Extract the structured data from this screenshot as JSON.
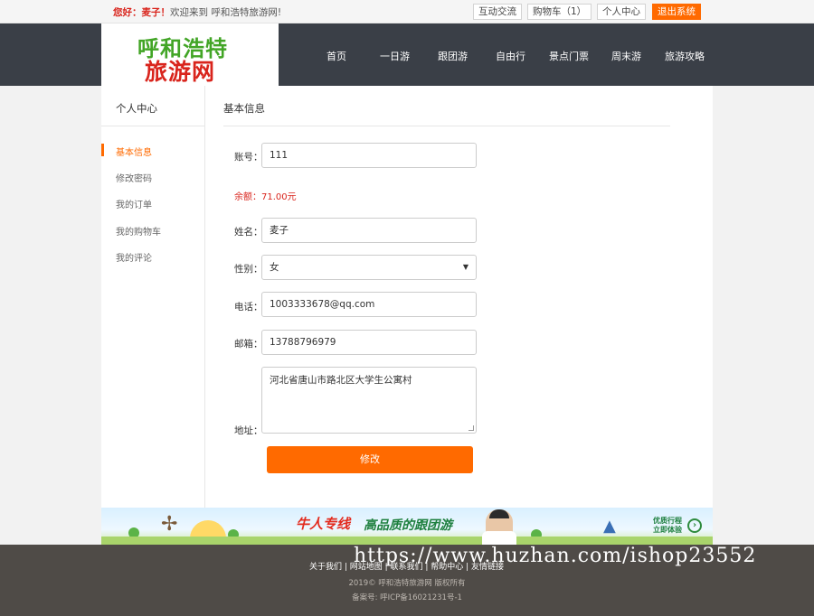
{
  "topbar": {
    "greeting": "您好：麦子！",
    "welcome": "欢迎来到 呼和浩特旅游网!",
    "buttons": [
      "互动交流",
      "购物车（1）",
      "个人中心",
      "退出系统"
    ]
  },
  "logo": {
    "line1": "呼和浩特",
    "line2": "旅游网"
  },
  "nav": [
    "首页",
    "一日游",
    "跟团游",
    "自由行",
    "景点门票",
    "周末游",
    "旅游攻略"
  ],
  "sidebar": {
    "title": "个人中心",
    "items": [
      "基本信息",
      "修改密码",
      "我的订单",
      "我的购物车",
      "我的评论"
    ],
    "active_index": 0
  },
  "form": {
    "title": "基本信息",
    "account_label": "账号：",
    "account_value": "111",
    "balance_text": "余额：71.00元",
    "name_label": "姓名：",
    "name_value": "麦子",
    "gender_label": "性别：",
    "gender_value": "女",
    "phone_label": "电话：",
    "phone_value": "1003333678@qq.com",
    "email_label": "邮箱：",
    "email_value": "13788796979",
    "address_label": "地址：",
    "address_value": "河北省唐山市路北区大学生公寓村",
    "submit_label": "修改"
  },
  "banner": {
    "slogan_red": "牛人专线",
    "slogan_green": "高品质的跟团游",
    "side_line1": "优质行程",
    "side_line2": "立即体验"
  },
  "footer": {
    "links": "关于我们 | 网站地图 | 联系我们 | 帮助中心 | 友情链接",
    "copyright": "2019© 呼和浩特旅游网 版权所有",
    "icp": "备案号: 呼ICP备16021231号-1"
  },
  "watermark": "https://www.huzhan.com/ishop23552",
  "colors": {
    "accent": "#ff6a00",
    "header_bg": "#3a3f47",
    "footer_bg": "#4f4b47",
    "alert_red": "#d9241c"
  }
}
